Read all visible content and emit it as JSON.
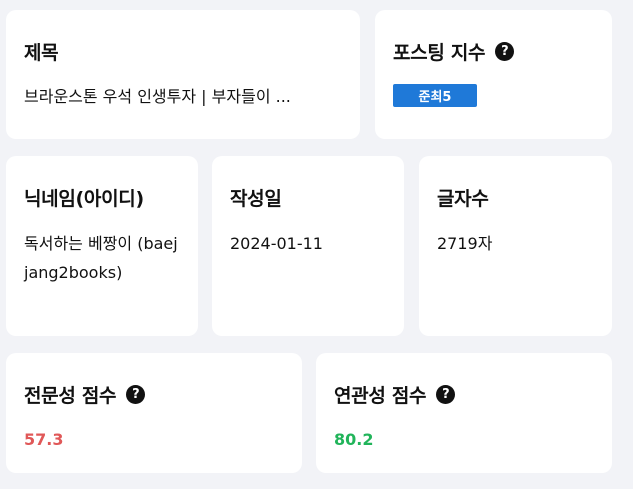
{
  "title_card": {
    "label": "제목",
    "value": "브라운스톤 우석 인생투자 | 부자들이 ..."
  },
  "posting_index": {
    "label": "포스팅 지수",
    "help": "?",
    "badge": "준최5"
  },
  "nickname": {
    "label": "닉네임(아이디)",
    "value": "독서하는 베짱이 (baejjang2books)"
  },
  "date": {
    "label": "작성일",
    "value": "2024-01-11"
  },
  "char_count": {
    "label": "글자수",
    "value": "2719자"
  },
  "expertise": {
    "label": "전문성 점수",
    "help": "?",
    "value": "57.3",
    "color": "#e05858"
  },
  "relevance": {
    "label": "연관성 점수",
    "help": "?",
    "value": "80.2",
    "color": "#21b45a"
  }
}
